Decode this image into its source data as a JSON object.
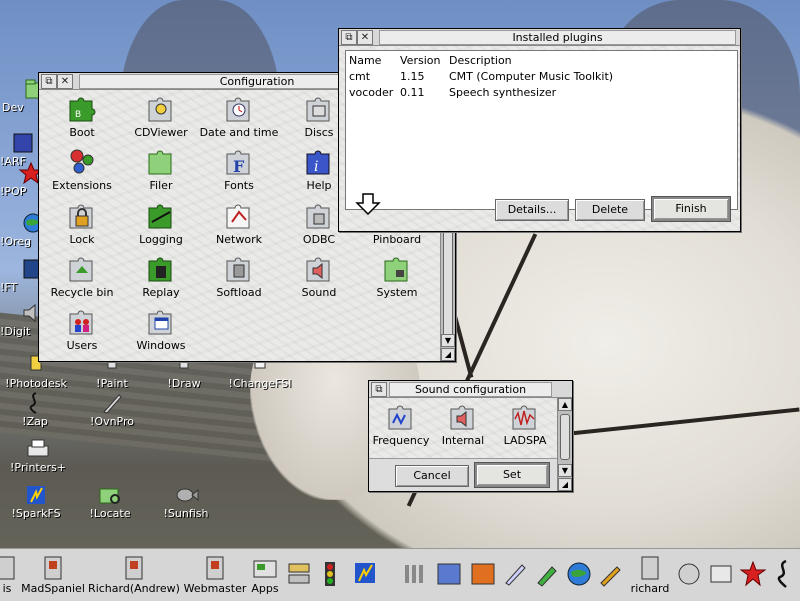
{
  "desktop": {
    "icons": [
      {
        "label": "Dev",
        "icon": "folder-icon"
      },
      {
        "label": "!ARF",
        "icon": "app-icon"
      },
      {
        "label": "!POP",
        "icon": "star-icon"
      },
      {
        "label": "!Oreg",
        "icon": "globe-icon"
      },
      {
        "label": "!FT",
        "icon": "app-icon"
      },
      {
        "label": "!Digit",
        "icon": "speaker-icon"
      },
      {
        "label": "!Photodesk",
        "icon": "paint-icon"
      },
      {
        "label": "!Paint",
        "icon": "paint-icon"
      },
      {
        "label": "!Draw",
        "icon": "draw-icon"
      },
      {
        "label": "!ChangeFSI",
        "icon": "image-icon"
      },
      {
        "label": "!Zap",
        "icon": "zap-icon"
      },
      {
        "label": "!OvnPro",
        "icon": "pen-icon"
      },
      {
        "label": "!Printers+",
        "icon": "printer-icon"
      },
      {
        "label": "!SparkFS",
        "icon": "spark-icon"
      },
      {
        "label": "!Locate",
        "icon": "locate-icon"
      },
      {
        "label": "!Sunfish",
        "icon": "fish-icon"
      }
    ]
  },
  "configuration": {
    "title": "Configuration",
    "items": [
      {
        "label": "Boot",
        "icon": "boot-icon"
      },
      {
        "label": "CDViewer",
        "icon": "cdviewer-icon"
      },
      {
        "label": "Date and time",
        "icon": "clock-icon"
      },
      {
        "label": "Discs",
        "icon": "discs-icon"
      },
      {
        "label": "Extensions",
        "icon": "gears-icon"
      },
      {
        "label": "Filer",
        "icon": "filer-icon"
      },
      {
        "label": "Fonts",
        "icon": "fonts-icon"
      },
      {
        "label": "Help",
        "icon": "help-icon"
      },
      {
        "label": "Lock",
        "icon": "lock-icon"
      },
      {
        "label": "Logging",
        "icon": "logging-icon"
      },
      {
        "label": "Network",
        "icon": "network-icon"
      },
      {
        "label": "ODBC",
        "icon": "odbc-icon"
      },
      {
        "label": "Pinboard",
        "icon": "pinboard-icon"
      },
      {
        "label": "Recycle bin",
        "icon": "recycle-icon"
      },
      {
        "label": "Replay",
        "icon": "replay-icon"
      },
      {
        "label": "Softload",
        "icon": "softload-icon"
      },
      {
        "label": "Sound",
        "icon": "sound-icon"
      },
      {
        "label": "System",
        "icon": "system-icon"
      },
      {
        "label": "Users",
        "icon": "users-icon"
      },
      {
        "label": "Windows",
        "icon": "windows-icon"
      }
    ]
  },
  "plugins": {
    "title": "Installed plugins",
    "headers": {
      "name": "Name",
      "version": "Version",
      "description": "Description"
    },
    "rows": [
      {
        "name": "cmt",
        "version": "1.15",
        "description": "CMT (Computer Music Toolkit)"
      },
      {
        "name": "vocoder",
        "version": "0.11",
        "description": "Speech synthesizer"
      }
    ],
    "buttons": {
      "details": "Details...",
      "delete": "Delete",
      "finish": "Finish"
    }
  },
  "sound": {
    "title": "Sound configuration",
    "items": [
      {
        "label": "Frequency",
        "icon": "frequency-icon"
      },
      {
        "label": "Internal",
        "icon": "speaker-icon"
      },
      {
        "label": "LADSPA",
        "icon": "waveform-icon"
      }
    ],
    "buttons": {
      "cancel": "Cancel",
      "set": "Set"
    }
  },
  "iconbar": {
    "items": [
      {
        "label": "is",
        "icon": "harddisc-icon"
      },
      {
        "label": "MadSpaniel",
        "icon": "harddisc-icon"
      },
      {
        "label": "Richard(Andrew)",
        "icon": "harddisc-icon"
      },
      {
        "label": "Webmaster",
        "icon": "harddisc-icon"
      },
      {
        "label": "Apps",
        "icon": "apps-icon"
      },
      {
        "label": "richard",
        "icon": "harddisc-icon"
      }
    ]
  },
  "colors": {
    "window_bg": "#dddddd",
    "titlebar": "#d8d8d8",
    "puzzle_green": "#3a9a2a",
    "puzzle_gray": "#cfd2d6"
  }
}
